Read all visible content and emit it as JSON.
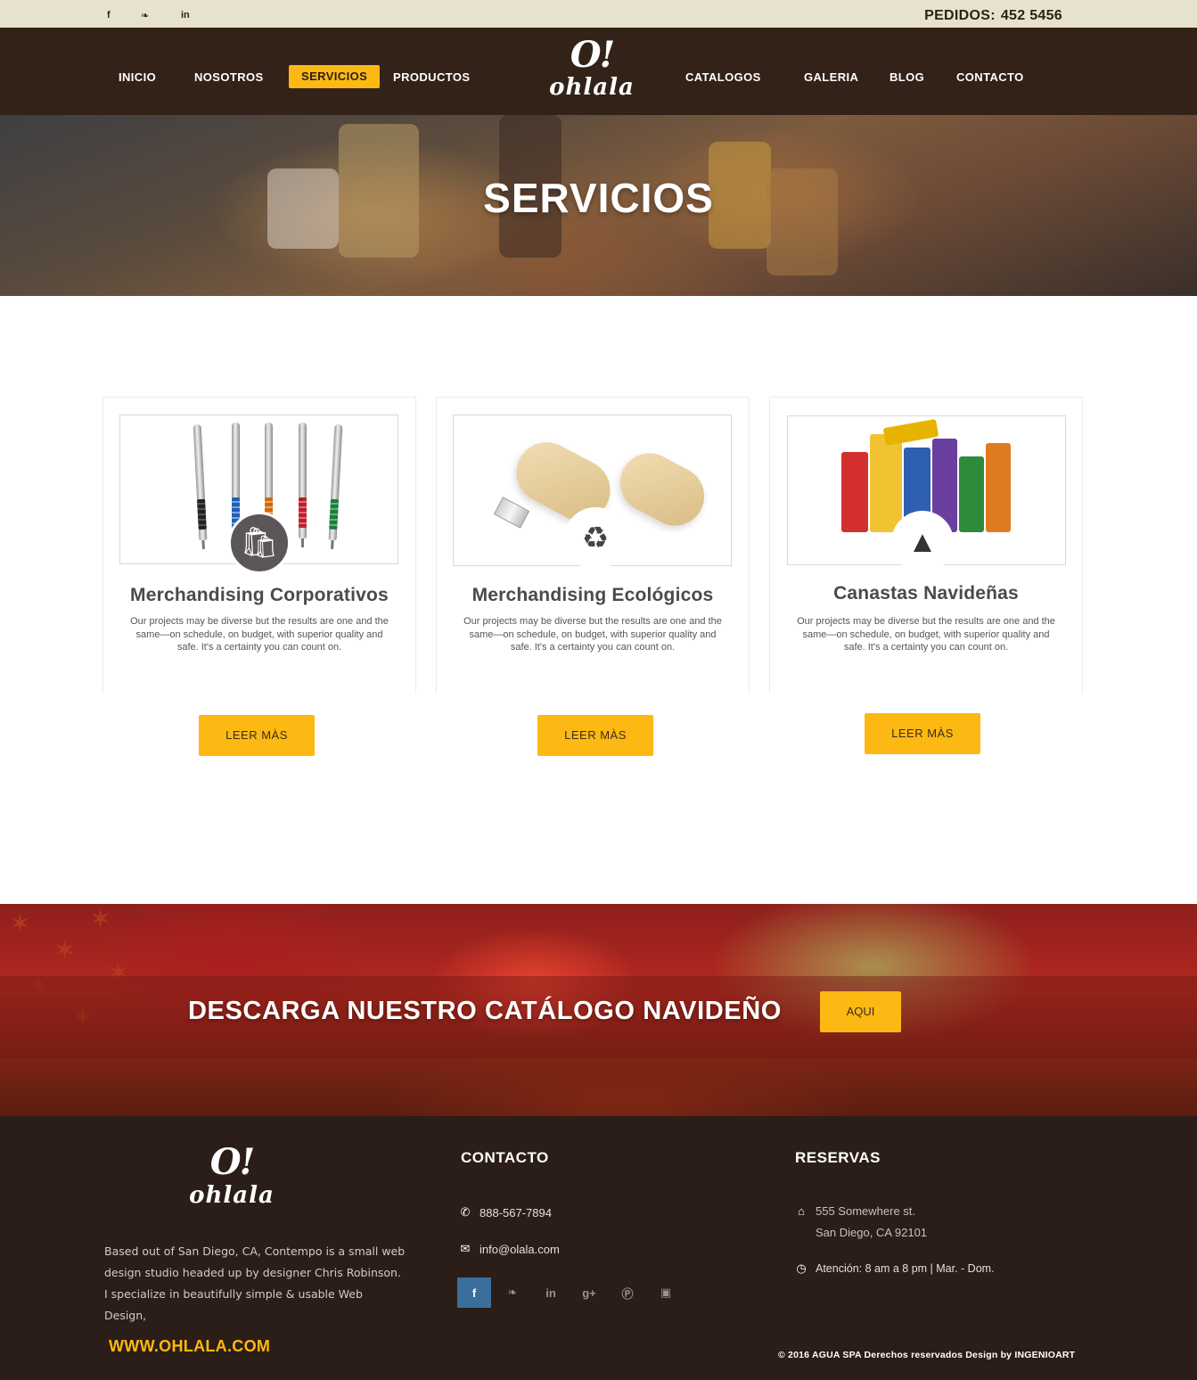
{
  "topbar": {
    "social": [
      {
        "icon": "facebook-icon",
        "glyph": "f"
      },
      {
        "icon": "twitter-icon",
        "glyph": "❧"
      },
      {
        "icon": "linkedin-icon",
        "glyph": "in"
      }
    ],
    "orders_label": "PEDIDOS:",
    "orders_number": "452 5456"
  },
  "nav": {
    "items": [
      {
        "label": "INICIO"
      },
      {
        "label": "NOSOTROS"
      },
      {
        "label": "SERVICIOS"
      },
      {
        "label": "PRODUCTOS"
      },
      {
        "label": "CATALOGOS"
      },
      {
        "label": "GALERIA"
      },
      {
        "label": "BLOG"
      },
      {
        "label": "CONTACTO"
      }
    ],
    "active": "SERVICIOS",
    "logo_mark": "O!",
    "logo_word": "ohlala"
  },
  "hero": {
    "title": "SERVICIOS"
  },
  "services": [
    {
      "title": "Merchandising Corporativos",
      "text": "Our projects may be diverse but the results are one and the same—on schedule, on budget, with superior quality and safe. It's a certainty you can count on.",
      "button": "LEER MÀS",
      "badge_icon": "shopping-bag-icon"
    },
    {
      "title": "Merchandising Ecológicos",
      "text": "Our projects may be diverse but the results are one and the same—on schedule, on budget, with superior quality and safe. It's a certainty you can count on.",
      "button": "LEER MÀS",
      "badge_icon": "recycle-icon"
    },
    {
      "title": "Canastas Navideñas",
      "text": "Our projects may be diverse but the results are one and the same—on schedule, on budget, with superior quality and safe. It's a certainty you can count on.",
      "button": "LEER MÀS",
      "badge_icon": "holly-icon"
    }
  ],
  "banner": {
    "cta": "DESCARGA NUESTRO CATÁLOGO NAVIDEÑO",
    "button": "AQUI"
  },
  "footer": {
    "logo_mark": "O!",
    "logo_word": "ohlala",
    "about": "Based out of San Diego, CA, Contempo is a small web design studio headed up by designer Chris Robinson. I specialize in beautifully simple & usable Web Design,",
    "site": "WWW.OHLALA.COM",
    "contact_heading": "CONTACTO",
    "phone": "888-567-7894",
    "email": "info@olala.com",
    "reservations_heading": "RESERVAS",
    "address_line1": "555 Somewhere st.",
    "address_line2": "San Diego, CA 92101",
    "hours": "Atención: 8 am a 8 pm  |  Mar. - Dom.",
    "social": [
      {
        "icon": "facebook-icon",
        "glyph": "f"
      },
      {
        "icon": "twitter-icon",
        "glyph": "❧"
      },
      {
        "icon": "linkedin-icon",
        "glyph": "in"
      },
      {
        "icon": "google-plus-icon",
        "glyph": "g+"
      },
      {
        "icon": "pinterest-icon",
        "glyph": "Ⓟ"
      },
      {
        "icon": "instagram-icon",
        "glyph": "▣"
      }
    ],
    "copyright": "© 2016   AGUA SPA   Derechos reservados Design by INGENIOART"
  },
  "colors": {
    "accent": "#fdb913",
    "nav_bg": "#322218",
    "topbar_bg": "#e7e2cd",
    "footer_bg": "#2b1d17"
  }
}
